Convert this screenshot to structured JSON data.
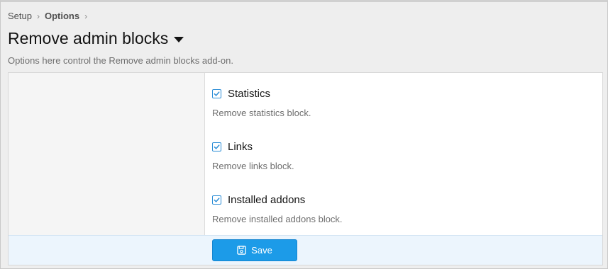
{
  "breadcrumb": {
    "items": [
      {
        "label": "Setup"
      },
      {
        "label": "Options"
      }
    ],
    "separator": "›"
  },
  "page": {
    "title": "Remove admin blocks",
    "description": "Options here control the Remove admin blocks add-on."
  },
  "options": [
    {
      "label": "Statistics",
      "hint": "Remove statistics block.",
      "checked": true
    },
    {
      "label": "Links",
      "hint": "Remove links block.",
      "checked": true
    },
    {
      "label": "Installed addons",
      "hint": "Remove installed addons block.",
      "checked": true
    }
  ],
  "footer": {
    "save_label": "Save",
    "save_icon": "floppy-disk-icon"
  },
  "colors": {
    "accent": "#1c9be8",
    "footer_bg": "#ecf5fd",
    "page_bg": "#eeeeee"
  }
}
